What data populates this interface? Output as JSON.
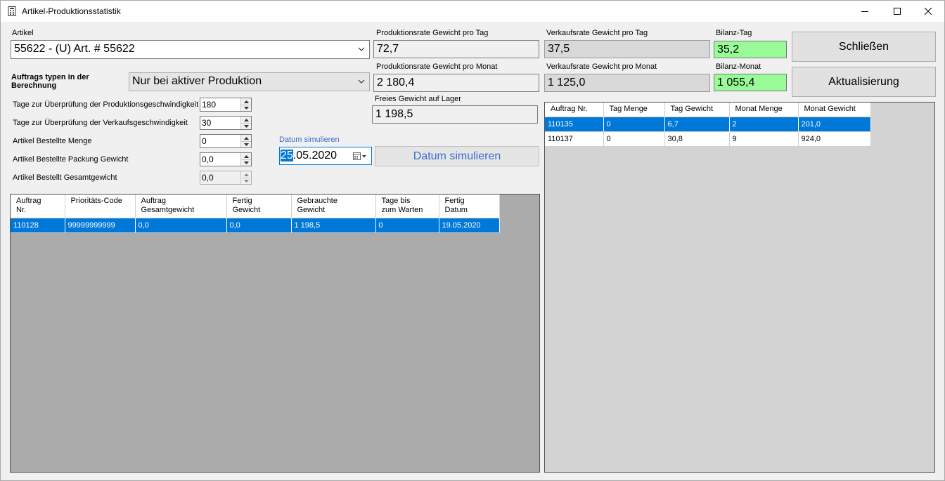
{
  "window": {
    "title": "Artikel-Produktionsstatistik"
  },
  "form": {
    "artikel_label": "Artikel",
    "artikel_value": "55622 - (U) Art. # 55622",
    "auftrags_label": "Auftrags typen in der Berechnung",
    "auftrags_value": "Nur bei aktiver Produktion",
    "tage_prod_label": "Tage zur Überprüfung der Produktionsgeschwindigkeit",
    "tage_prod_value": "180",
    "tage_verk_label": "Tage zur Überprüfung der Verkaufsgeschwindigkeit",
    "tage_verk_value": "30",
    "bestellte_menge_label": "Artikel Bestellte Menge",
    "bestellte_menge_value": "0",
    "packung_gewicht_label": "Artikel Bestellte Packung Gewicht",
    "packung_gewicht_value": "0,0",
    "gesamtgewicht_label": "Artikel Bestellt Gesamtgewicht",
    "gesamtgewicht_value": "0,0",
    "datum_label": "Datum simulieren",
    "datum_day": "25",
    "datum_rest": ".05.2020",
    "datum_button": "Datum simulieren"
  },
  "stats": {
    "prod_tag_label": "Produktionsrate Gewicht pro Tag",
    "prod_tag_value": "72,7",
    "prod_monat_label": "Produktionsrate Gewicht pro Monat",
    "prod_monat_value": "2 180,4",
    "freies_label": "Freies Gewicht auf Lager",
    "freies_value": "1 198,5",
    "verk_tag_label": "Verkaufsrate Gewicht pro Tag",
    "verk_tag_value": "37,5",
    "verk_monat_label": "Verkaufsrate Gewicht pro Monat",
    "verk_monat_value": "1 125,0",
    "bilanz_tag_label": "Bilanz-Tag",
    "bilanz_tag_value": "35,2",
    "bilanz_monat_label": "Bilanz-Monat",
    "bilanz_monat_value": "1 055,4"
  },
  "buttons": {
    "close": "Schließen",
    "refresh": "Aktualisierung"
  },
  "left_grid": {
    "headers": [
      [
        "Auftrag",
        "Nr."
      ],
      [
        "Prioritäts-Code",
        ""
      ],
      [
        "Auftrag",
        "Gesamtgewicht"
      ],
      [
        "Fertig",
        "Gewicht"
      ],
      [
        "Gebrauchte",
        "Gewicht"
      ],
      [
        "Tage bis",
        "zum Warten"
      ],
      [
        "Fertig",
        "Datum"
      ]
    ],
    "rows": [
      {
        "selected": true,
        "cells": [
          "110128",
          "99999999999",
          "0,0",
          "0,0",
          "1 198,5",
          "0",
          "19.05.2020"
        ]
      }
    ]
  },
  "right_grid": {
    "headers": [
      "Auftrag Nr.",
      "Tag Menge",
      "Tag Gewicht",
      "Monat Menge",
      "Monat Gewicht"
    ],
    "rows": [
      {
        "selected": true,
        "cells": [
          "110135",
          "0",
          "6,7",
          "2",
          "201,0"
        ]
      },
      {
        "selected": false,
        "cells": [
          "110137",
          "0",
          "30,8",
          "9",
          "924,0"
        ]
      }
    ]
  },
  "colors": {
    "accent": "#0078d7",
    "green": "#98fb98",
    "grid_bg": "#ababab",
    "panel_bg": "#d3d3d3"
  }
}
